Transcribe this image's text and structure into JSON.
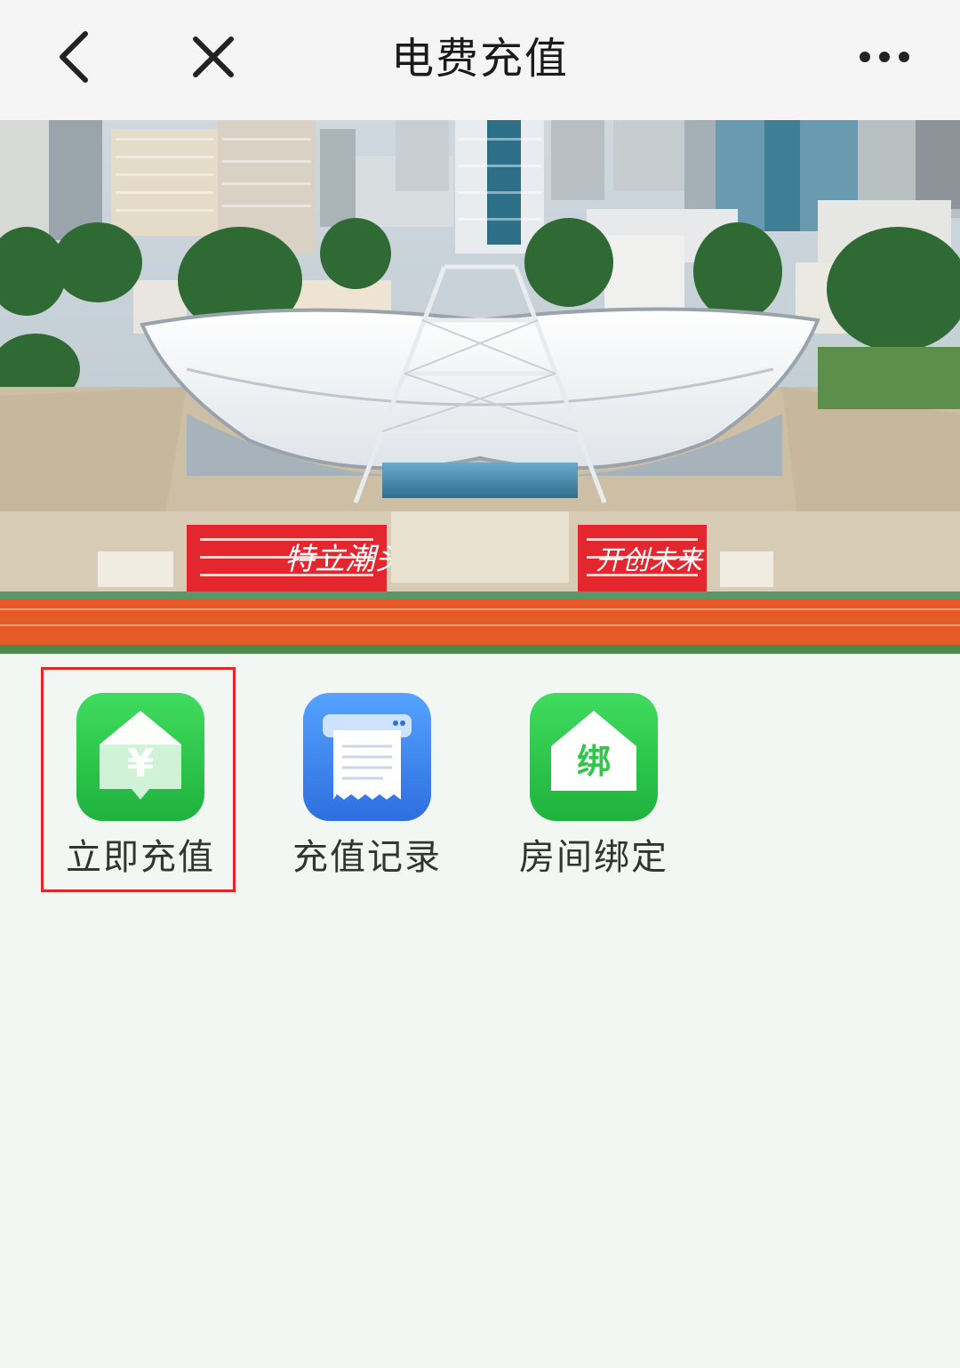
{
  "header": {
    "title": "电费充值",
    "back_icon": "chevron-left-icon",
    "close_icon": "close-icon",
    "more_icon": "more-horizontal-icon"
  },
  "banner": {
    "image": "stadium-photo",
    "sign_left": "特立潮头",
    "sign_right": "开创未来"
  },
  "menu": {
    "items": [
      {
        "label": "立即充值",
        "icon": "house-yen-icon",
        "color": "#2ec74a",
        "selected": true
      },
      {
        "label": "充值记录",
        "icon": "receipt-printer-icon",
        "color": "#3a86f0"
      },
      {
        "label": "房间绑定",
        "icon": "house-bind-icon",
        "color": "#2ec74a",
        "badge": "绑"
      }
    ]
  },
  "colors": {
    "highlight": "#e8232a",
    "background": "#f3f7f4"
  }
}
